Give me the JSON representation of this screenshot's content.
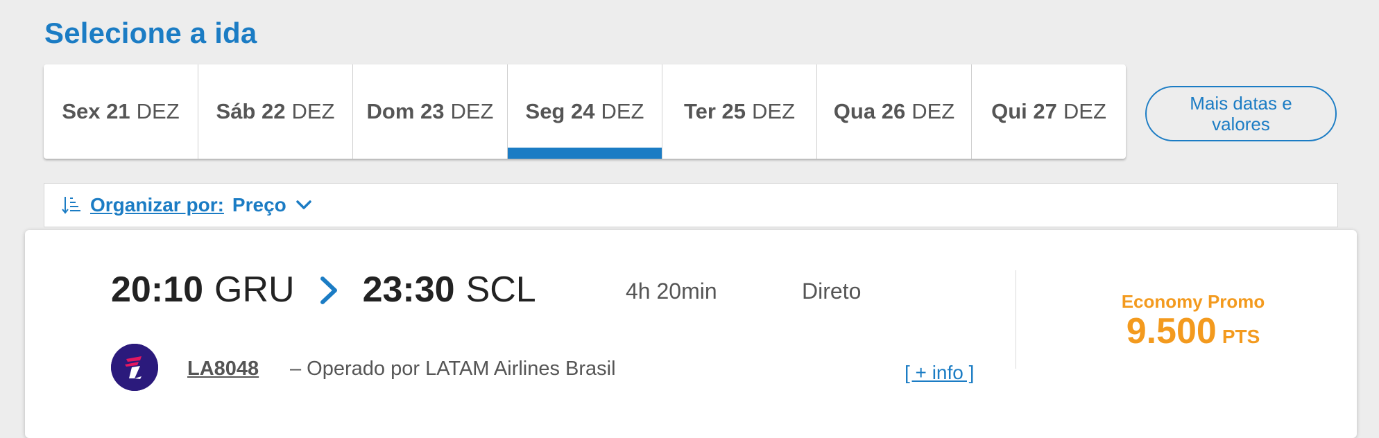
{
  "page": {
    "title": "Selecione a ida"
  },
  "date_tabs": [
    {
      "day": "Sex 21",
      "month": "DEZ",
      "selected": false
    },
    {
      "day": "Sáb 22",
      "month": "DEZ",
      "selected": false
    },
    {
      "day": "Dom 23",
      "month": "DEZ",
      "selected": false
    },
    {
      "day": "Seg 24",
      "month": "DEZ",
      "selected": true
    },
    {
      "day": "Ter 25",
      "month": "DEZ",
      "selected": false
    },
    {
      "day": "Qua 26",
      "month": "DEZ",
      "selected": false
    },
    {
      "day": "Qui 27",
      "month": "DEZ",
      "selected": false
    }
  ],
  "more_dates": {
    "line1": "Mais datas e",
    "line2": "valores"
  },
  "sort": {
    "label": "Organizar por:",
    "value": "Preço"
  },
  "flight": {
    "departure_time": "20:10",
    "departure_airport": "GRU",
    "arrival_time": "23:30",
    "arrival_airport": "SCL",
    "duration": "4h 20min",
    "stops": "Direto",
    "flight_number": "LA8048",
    "operated_by": "– Operado por LATAM Airlines Brasil",
    "more_info": "[ + info ]",
    "fare_class": "Economy Promo",
    "price": "9.500",
    "price_unit": "PTS"
  },
  "colors": {
    "accent": "#1b7cc4",
    "price": "#f39a1e",
    "airline_logo_bg": "#2b1a7c",
    "background": "#ededed"
  },
  "icons": {
    "sort": "sort-icon",
    "chevron": "chevron-down-icon",
    "route_arrow": "chevron-right-icon",
    "airline_logo": "latam-logo-icon"
  }
}
